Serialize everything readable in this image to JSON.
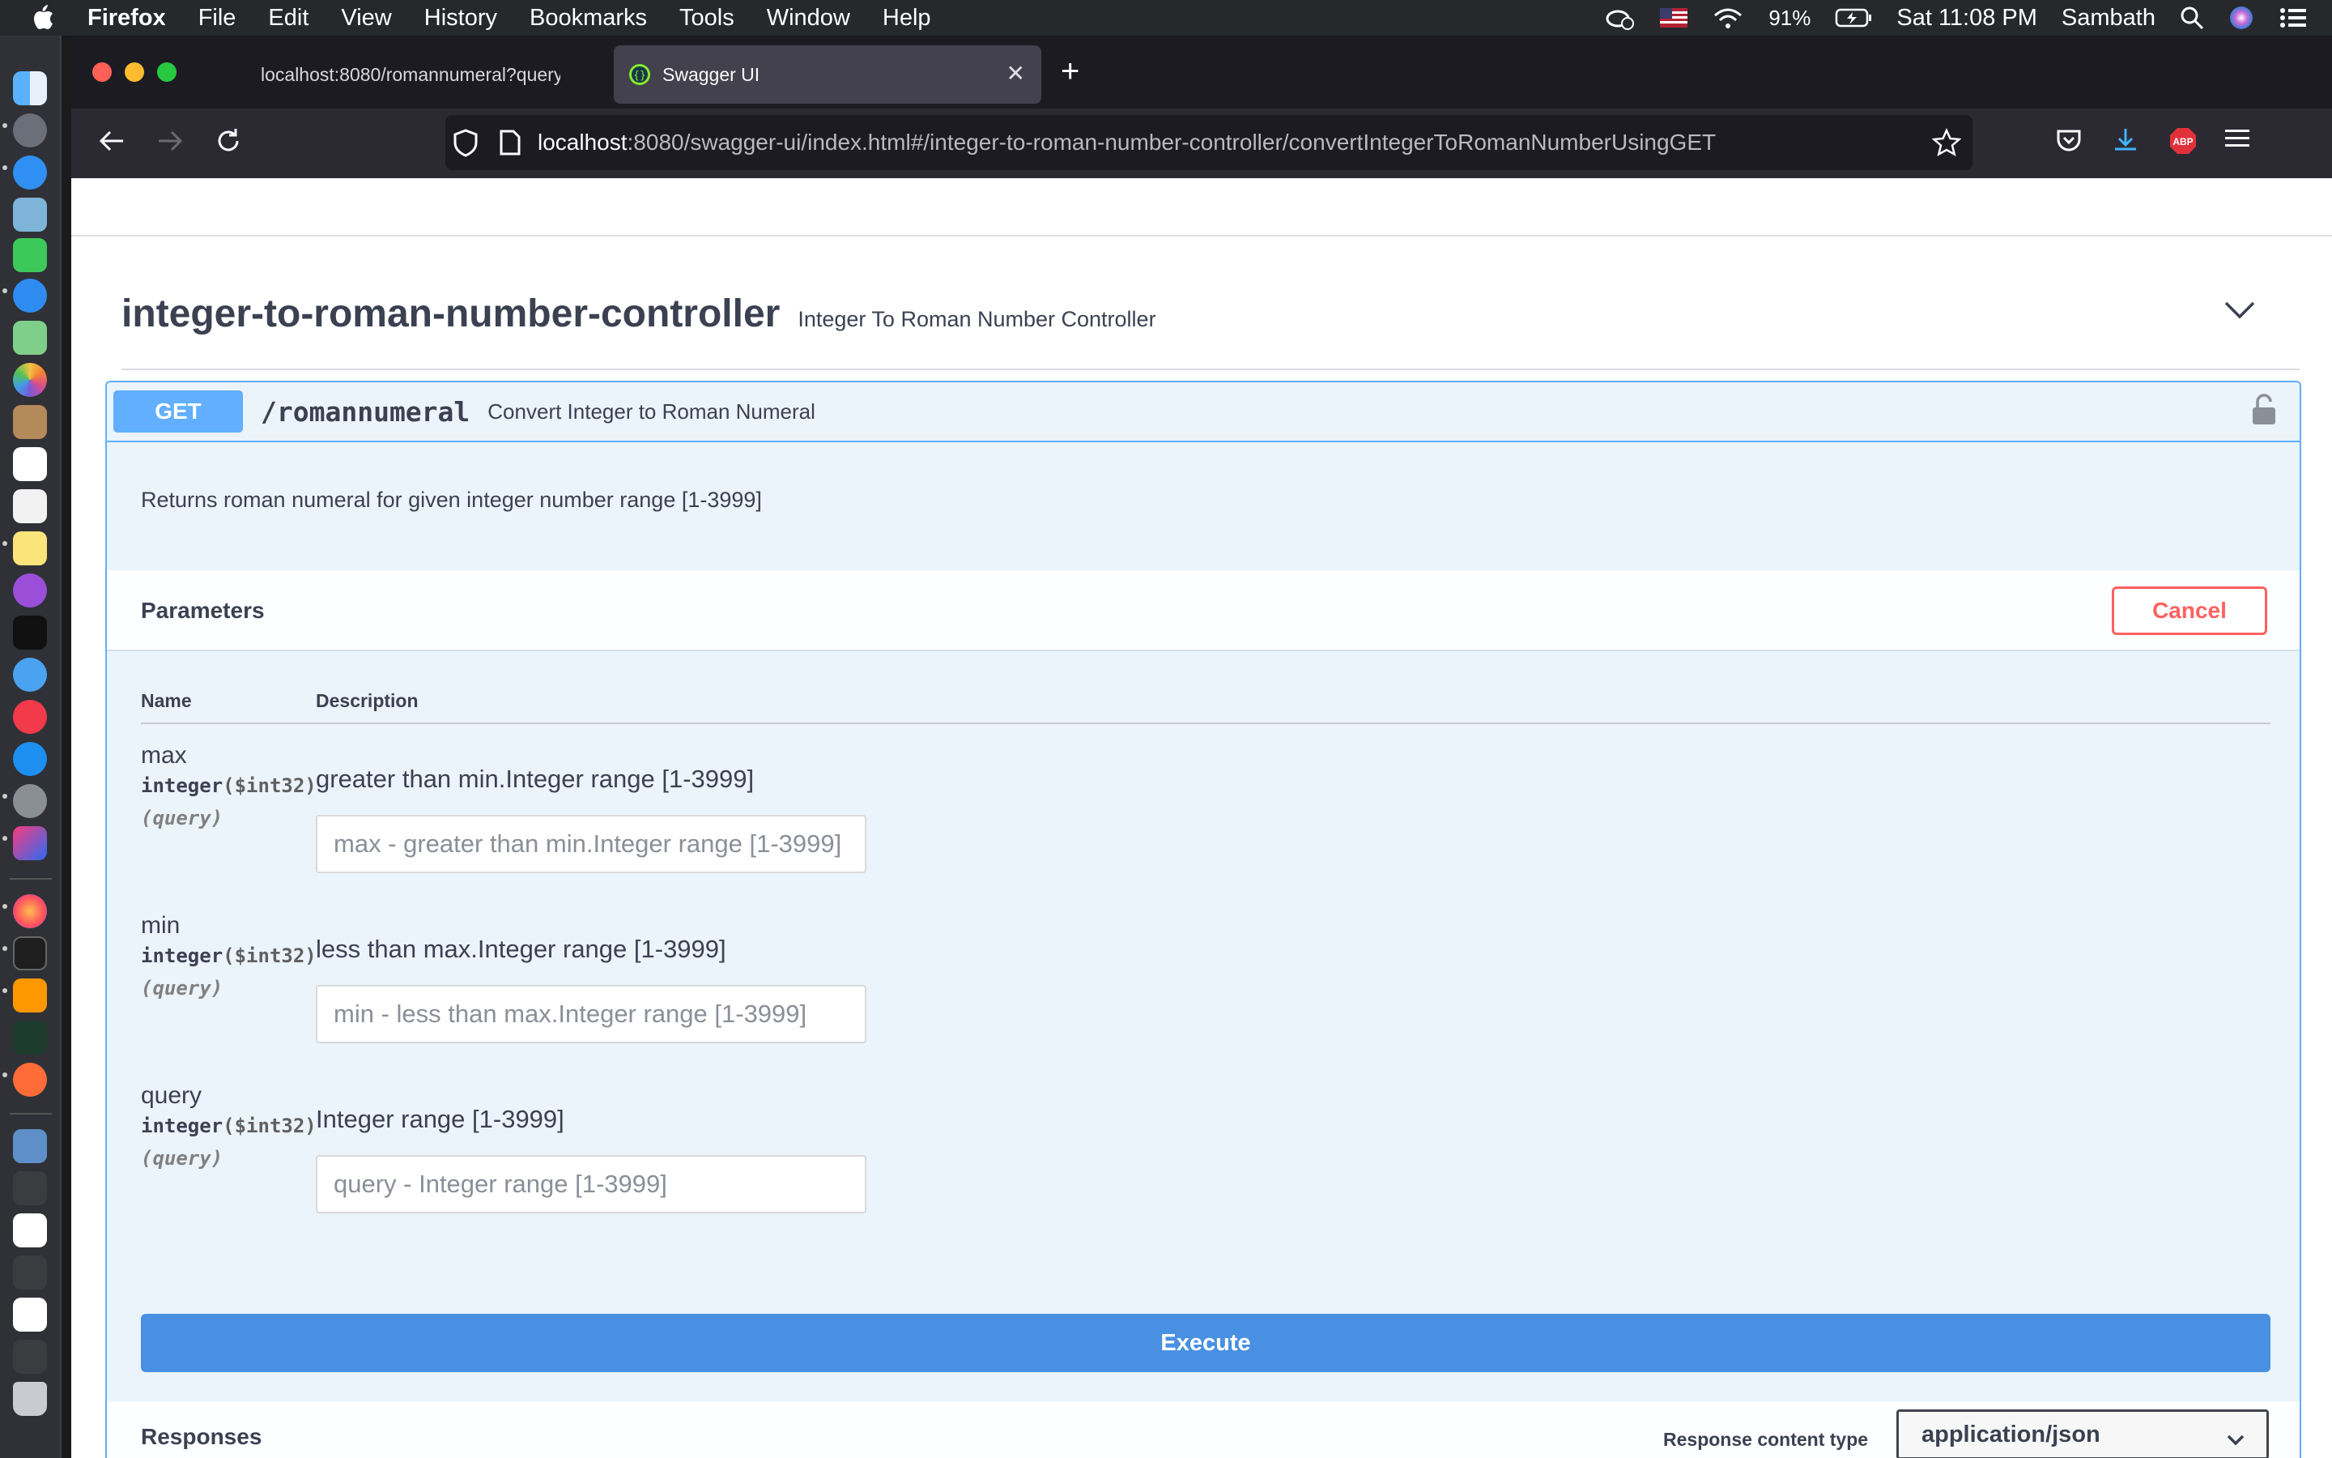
{
  "menubar": {
    "app_name": "Firefox",
    "menus": [
      "File",
      "Edit",
      "View",
      "History",
      "Bookmarks",
      "Tools",
      "Window",
      "Help"
    ],
    "battery": "91%",
    "clock": "Sat 11:08 PM",
    "user": "Sambath"
  },
  "browser": {
    "tabs": [
      {
        "title": "localhost:8080/romannumeral?query",
        "active": false
      },
      {
        "title": "Swagger UI",
        "active": true
      }
    ],
    "url_host": "localhost",
    "url_path": ":8080/swagger-ui/index.html#/integer-to-roman-number-controller/convertIntegerToRomanNumberUsingGET"
  },
  "controller": {
    "name": "integer-to-roman-number-controller",
    "description": "Integer To Roman Number Controller"
  },
  "operation": {
    "method": "GET",
    "path": "/romannumeral",
    "summary": "Convert Integer to Roman Numeral",
    "description": "Returns roman numeral for given integer number range [1-3999]",
    "method_color": "#61affe"
  },
  "parameters": {
    "title": "Parameters",
    "cancel_label": "Cancel",
    "col_name": "Name",
    "col_description": "Description",
    "items": [
      {
        "name": "max",
        "type": "integer",
        "format": "($int32)",
        "in": "(query)",
        "description": "greater than min.Integer range [1-3999]",
        "placeholder": "max - greater than min.Integer range [1-3999]",
        "value": ""
      },
      {
        "name": "min",
        "type": "integer",
        "format": "($int32)",
        "in": "(query)",
        "description": "less than max.Integer range [1-3999]",
        "placeholder": "min - less than max.Integer range [1-3999]",
        "value": ""
      },
      {
        "name": "query",
        "type": "integer",
        "format": "($int32)",
        "in": "(query)",
        "description": "Integer range [1-3999]",
        "placeholder": "query - Integer range [1-3999]",
        "value": ""
      }
    ]
  },
  "execute_label": "Execute",
  "responses": {
    "title": "Responses",
    "content_type_label": "Response content type",
    "content_type": "application/json"
  },
  "colors": {
    "execute": "#4990e2",
    "cancel": "#ff6060",
    "opblock_bg": "#ebf3fb"
  }
}
